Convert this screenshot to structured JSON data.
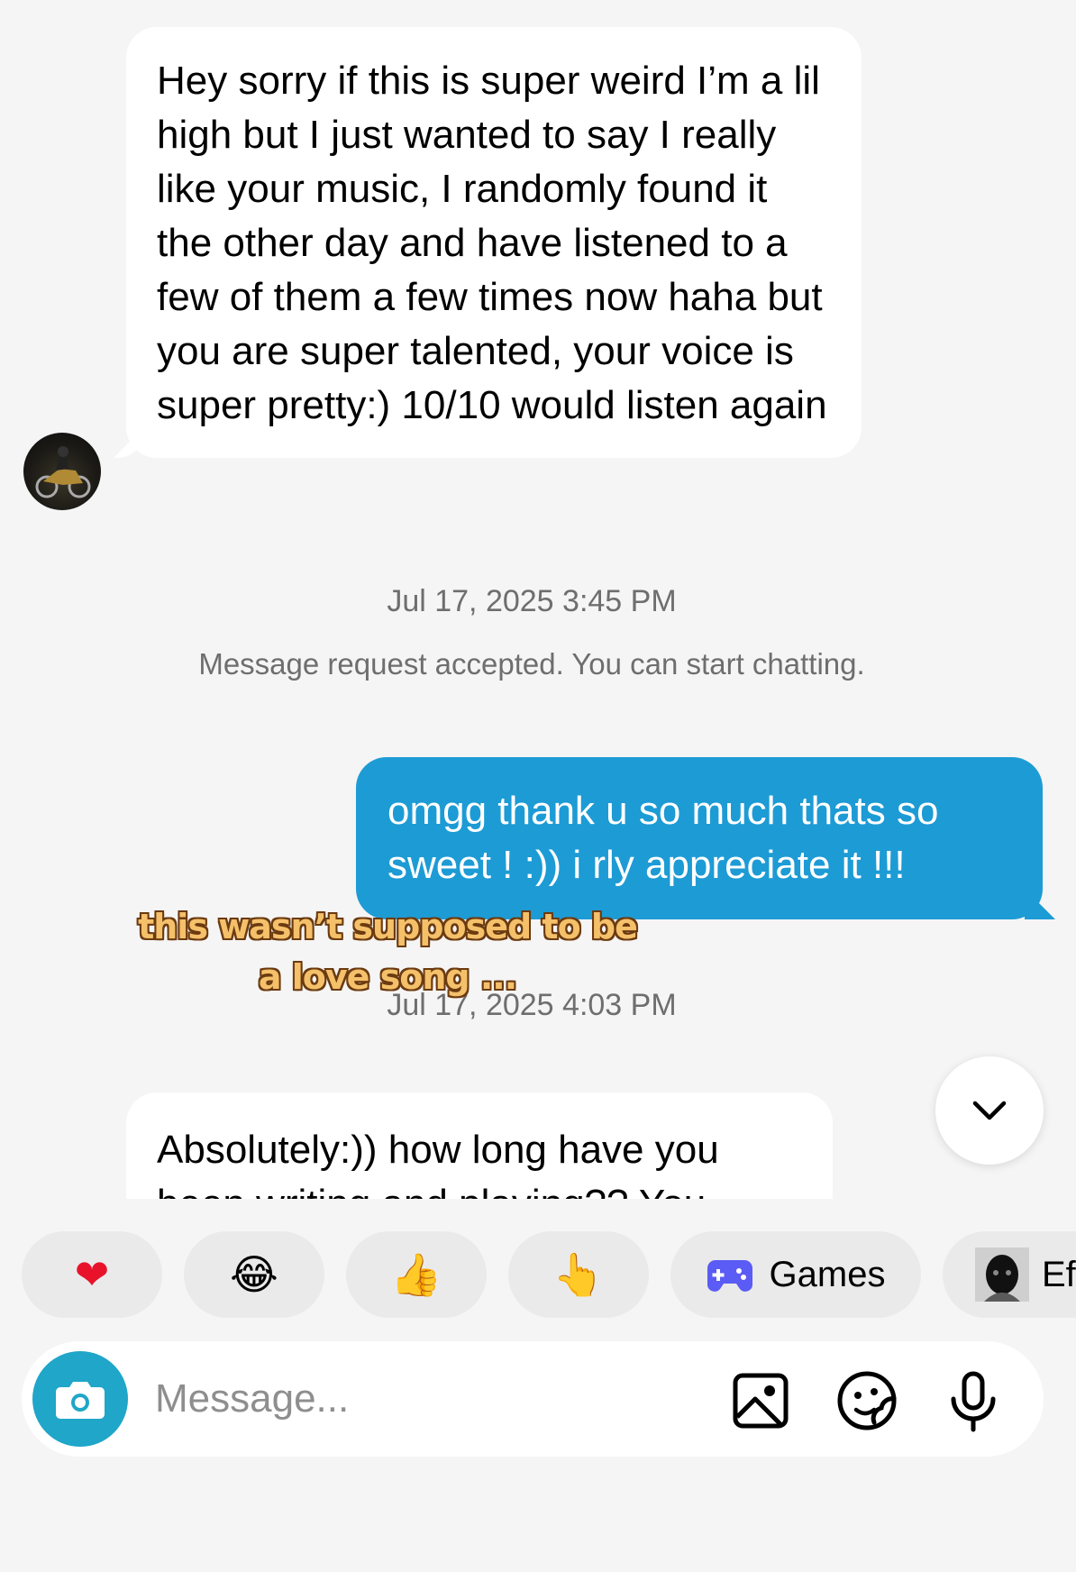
{
  "messages": {
    "incoming_1": "Hey sorry if this is super weird I’m a lil high but I just wanted to say I really like your music, I randomly found it the other day and have listened to a few of them a few times now haha but you are super talented, your voice is super pretty:) 10/10 would listen again",
    "timestamp_1": "Jul 17, 2025 3:45 PM",
    "system_notice": "Message request accepted. You can start chatting.",
    "outgoing_1": "omgg thank u so much thats so sweet ! :)) i rly appreciate it !!!",
    "timestamp_2": "Jul 17, 2025 4:03 PM",
    "incoming_2": "Absolutely:)) how long have you been writing and playing?? You"
  },
  "overlay_caption": {
    "line1": "this wasn’t supposed to be",
    "line2": "a love song ..."
  },
  "reactions": [
    {
      "icon": "red-heart-icon",
      "glyph": "❤"
    },
    {
      "icon": "laughing-tears-icon",
      "glyph": "😂"
    },
    {
      "icon": "thumbs-up-icon",
      "glyph": "👍"
    },
    {
      "icon": "pointing-hand-icon",
      "glyph": "👆"
    }
  ],
  "chips": {
    "games_label": "Games",
    "effects_label": "Ef"
  },
  "composer": {
    "placeholder": "Message..."
  },
  "colors": {
    "outgoing_bubble": "#1d9bd5",
    "camera_button": "#1fa6c9",
    "games_icon": "#5b5bf5"
  }
}
